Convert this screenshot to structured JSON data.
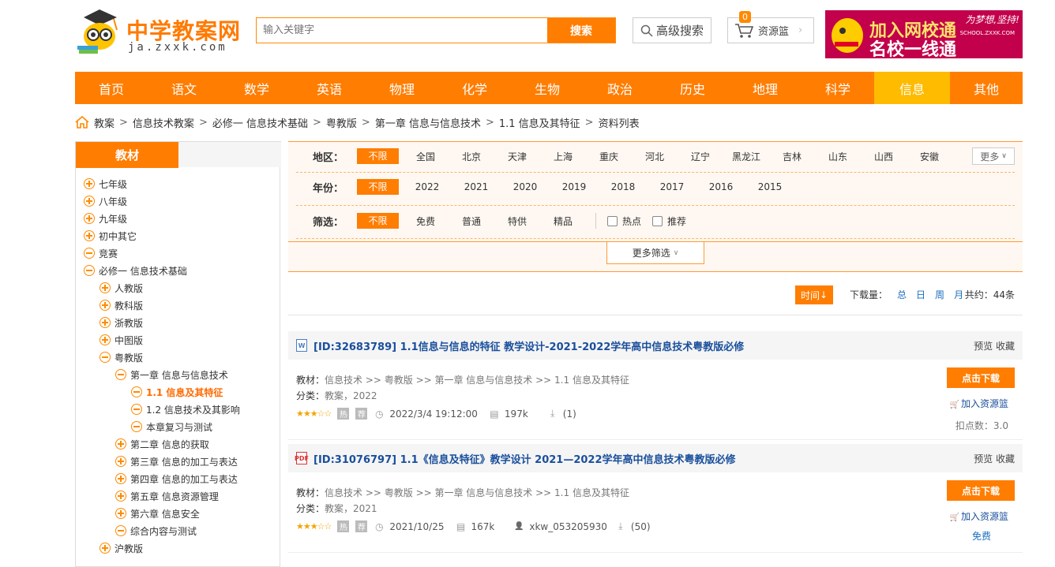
{
  "header": {
    "logo_text": "中学教案网",
    "logo_sub": "ja.zxxk.com",
    "search_placeholder": "输入关键字",
    "search_button": "搜索",
    "advanced_search": "高级搜索",
    "cart_label": "资源篮",
    "cart_count": "0",
    "banner_line1": "加入网校通",
    "banner_line2": "名校一线通",
    "banner_brand": "网校通",
    "banner_tag": "为梦想,坚持!",
    "banner_site": "SCHOOL.ZXXK.COM"
  },
  "nav": [
    "首页",
    "语文",
    "数学",
    "英语",
    "物理",
    "化学",
    "生物",
    "政治",
    "历史",
    "地理",
    "科学",
    "信息",
    "其他"
  ],
  "nav_active": "信息",
  "breadcrumb": [
    "教案",
    "信息技术教案",
    "必修一 信息技术基础",
    "粤教版",
    "第一章 信息与信息技术",
    "1.1 信息及其特征",
    "资料列表"
  ],
  "sidebar": {
    "title": "教材",
    "tree": [
      {
        "label": "七年级",
        "icon": "plus",
        "level": 0
      },
      {
        "label": "八年级",
        "icon": "plus",
        "level": 0
      },
      {
        "label": "九年级",
        "icon": "plus",
        "level": 0
      },
      {
        "label": "初中其它",
        "icon": "plus",
        "level": 0
      },
      {
        "label": "竞赛",
        "icon": "minus",
        "level": 0
      },
      {
        "label": "必修一 信息技术基础",
        "icon": "minus",
        "level": 0
      },
      {
        "label": "人教版",
        "icon": "plus",
        "level": 1
      },
      {
        "label": "教科版",
        "icon": "plus",
        "level": 1
      },
      {
        "label": "浙教版",
        "icon": "plus",
        "level": 1
      },
      {
        "label": "中图版",
        "icon": "plus",
        "level": 1
      },
      {
        "label": "粤教版",
        "icon": "minus",
        "level": 1
      },
      {
        "label": "第一章 信息与信息技术",
        "icon": "minus",
        "level": 2
      },
      {
        "label": "1.1 信息及其特征",
        "icon": "minus",
        "level": 3,
        "current": true
      },
      {
        "label": "1.2 信息技术及其影响",
        "icon": "minus",
        "level": 3
      },
      {
        "label": "本章复习与测试",
        "icon": "minus",
        "level": 3
      },
      {
        "label": "第二章 信息的获取",
        "icon": "plus",
        "level": 2
      },
      {
        "label": "第三章 信息的加工与表达",
        "icon": "plus",
        "level": 2
      },
      {
        "label": "第四章 信息的加工与表达",
        "icon": "plus",
        "level": 2
      },
      {
        "label": "第五章 信息资源管理",
        "icon": "plus",
        "level": 2
      },
      {
        "label": "第六章 信息安全",
        "icon": "plus",
        "level": 2
      },
      {
        "label": "综合内容与测试",
        "icon": "minus",
        "level": 2
      },
      {
        "label": "沪教版",
        "icon": "plus",
        "level": 1
      }
    ]
  },
  "filters": {
    "region_label": "地区：",
    "region_options": [
      "不限",
      "全国",
      "北京",
      "天津",
      "上海",
      "重庆",
      "河北",
      "辽宁",
      "黑龙江",
      "吉林",
      "山东",
      "山西",
      "安徽"
    ],
    "region_more": "更多",
    "year_label": "年份：",
    "year_options": [
      "不限",
      "2022",
      "2021",
      "2020",
      "2019",
      "2018",
      "2017",
      "2016",
      "2015"
    ],
    "screen_label": "筛选：",
    "screen_options": [
      "不限",
      "免费",
      "普通",
      "特供",
      "精品"
    ],
    "check_hot": "热点",
    "check_rec": "推荐",
    "more_filter": "更多筛选"
  },
  "sort": {
    "time_label": "时间",
    "downloads_label": "下载量：",
    "download_links": [
      "总",
      "日",
      "周",
      "月"
    ],
    "total": "共约：44条"
  },
  "items": [
    {
      "file_type": "W",
      "title": "[ID:32683789] 1.1信息与信息的特征 教学设计-2021-2022学年高中信息技术粤教版必修",
      "preview": "预览",
      "collect": "收藏",
      "material_label": "教材：",
      "material": "信息技术 >> 粤教版 >> 第一章 信息与信息技术 >> 1.1 信息及其特征",
      "category_label": "分类：",
      "category": "教案，2022",
      "stars": "★★★☆☆",
      "hot": "热",
      "rec": "荐",
      "date": "2022/3/4 19:12:00",
      "size": "197k",
      "author": "",
      "downloads": "(1)",
      "download_btn": "点击下载",
      "add_cart": "加入资源篮",
      "points": "扣点数：3.0",
      "free": ""
    },
    {
      "file_type": "PDF",
      "title": "[ID:31076797] 1.1《信息及特征》教学设计 2021—2022学年高中信息技术粤教版必修",
      "preview": "预览",
      "collect": "收藏",
      "material_label": "教材：",
      "material": "信息技术 >> 粤教版 >> 第一章 信息与信息技术 >> 1.1 信息及其特征",
      "category_label": "分类：",
      "category": "教案，2021",
      "stars": "★★★☆☆",
      "hot": "热",
      "rec": "荐",
      "date": "2021/10/25",
      "size": "167k",
      "author": "xkw_053205930",
      "downloads": "(50)",
      "download_btn": "点击下载",
      "add_cart": "加入资源篮",
      "points": "",
      "free": "免费"
    }
  ],
  "colors": {
    "accent": "#ff7d00",
    "nav_active": "#ffbb00",
    "link": "#1a4f9c"
  }
}
